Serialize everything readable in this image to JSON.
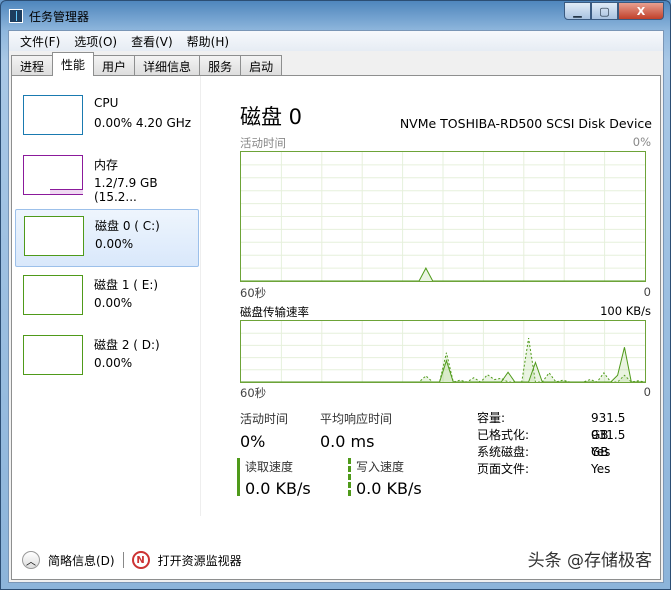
{
  "window": {
    "title": "任务管理器",
    "minimize": "▁",
    "maximize": "▢",
    "close": "X"
  },
  "menu": [
    "文件(F)",
    "选项(O)",
    "查看(V)",
    "帮助(H)"
  ],
  "tabs": [
    "进程",
    "性能",
    "用户",
    "详细信息",
    "服务",
    "启动"
  ],
  "active_tab": 1,
  "sidebar": [
    {
      "name": "CPU",
      "value": "0.00%  4.20 GHz",
      "color": "#1a7ab0"
    },
    {
      "name": "内存",
      "value": "1.2/7.9 GB (15.2...",
      "color": "#8b1a9b"
    },
    {
      "name": "磁盘 0 ( C:)",
      "value": "0.00%",
      "color": "#4f9a1a"
    },
    {
      "name": "磁盘 1 ( E:)",
      "value": "0.00%",
      "color": "#4f9a1a"
    },
    {
      "name": "磁盘 2 ( D:)",
      "value": "0.00%",
      "color": "#4f9a1a"
    }
  ],
  "main": {
    "title": "磁盘 0",
    "device": "NVMe TOSHIBA-RD500 SCSI Disk Device",
    "activity_label": "活动时间",
    "activity_max": "0%",
    "time_left": "60秒",
    "time_right": "0",
    "transfer_label": "磁盘传输速率",
    "transfer_max": "100 KB/s",
    "active_time_label": "活动时间",
    "active_time": "0%",
    "response_label": "平均响应时间",
    "response": "0.0 ms",
    "read_label": "读取速度",
    "read": "0.0 KB/s",
    "write_label": "写入速度",
    "write": "0.0 KB/s",
    "props": [
      {
        "k": "容量:",
        "v": "931.5 GB"
      },
      {
        "k": "已格式化:",
        "v": "931.5 GB"
      },
      {
        "k": "系统磁盘:",
        "v": "Yes"
      },
      {
        "k": "页面文件:",
        "v": "Yes"
      }
    ]
  },
  "footer": {
    "summary": "简略信息(D)",
    "resmon": "打开资源监视器"
  },
  "watermark": "头条 @存储极客",
  "chart_data": [
    {
      "type": "area",
      "title": "活动时间",
      "ylim": [
        0,
        100
      ],
      "x_range": [
        "60秒",
        "0"
      ],
      "values": [
        0,
        0,
        0,
        0,
        0,
        0,
        0,
        0,
        0,
        0,
        0,
        0,
        0,
        0,
        0,
        0,
        0,
        0,
        0,
        0,
        0,
        0,
        0,
        0,
        0,
        0,
        0,
        10,
        0,
        0,
        0,
        0,
        0,
        0,
        0,
        0,
        0,
        0,
        0,
        0,
        0,
        0,
        0,
        0,
        0,
        0,
        0,
        0,
        0,
        0,
        0,
        0,
        0,
        0,
        0,
        0,
        0,
        0,
        0,
        0
      ]
    },
    {
      "type": "line",
      "title": "磁盘传输速率",
      "ylim": [
        0,
        100
      ],
      "unit": "KB/s",
      "x_range": [
        "60秒",
        "0"
      ],
      "series": [
        {
          "name": "read",
          "values": [
            0,
            0,
            0,
            0,
            0,
            0,
            0,
            0,
            0,
            0,
            0,
            0,
            0,
            0,
            0,
            0,
            0,
            0,
            0,
            0,
            0,
            0,
            0,
            0,
            0,
            0,
            0,
            0,
            0,
            0,
            35,
            0,
            0,
            0,
            0,
            0,
            0,
            0,
            0,
            16,
            0,
            0,
            0,
            32,
            0,
            0,
            0,
            0,
            0,
            0,
            0,
            0,
            0,
            0,
            0,
            11,
            57,
            0,
            0,
            0
          ]
        },
        {
          "name": "write",
          "values": [
            0,
            0,
            0,
            0,
            0,
            0,
            0,
            0,
            0,
            0,
            0,
            0,
            0,
            0,
            0,
            0,
            0,
            0,
            0,
            0,
            0,
            0,
            0,
            0,
            0,
            0,
            0,
            10,
            0,
            0,
            48,
            0,
            3,
            0,
            7,
            0,
            12,
            4,
            6,
            0,
            0,
            0,
            72,
            0,
            0,
            15,
            0,
            3,
            0,
            0,
            0,
            4,
            0,
            15,
            0,
            0,
            11,
            0,
            2,
            0
          ]
        }
      ]
    }
  ]
}
